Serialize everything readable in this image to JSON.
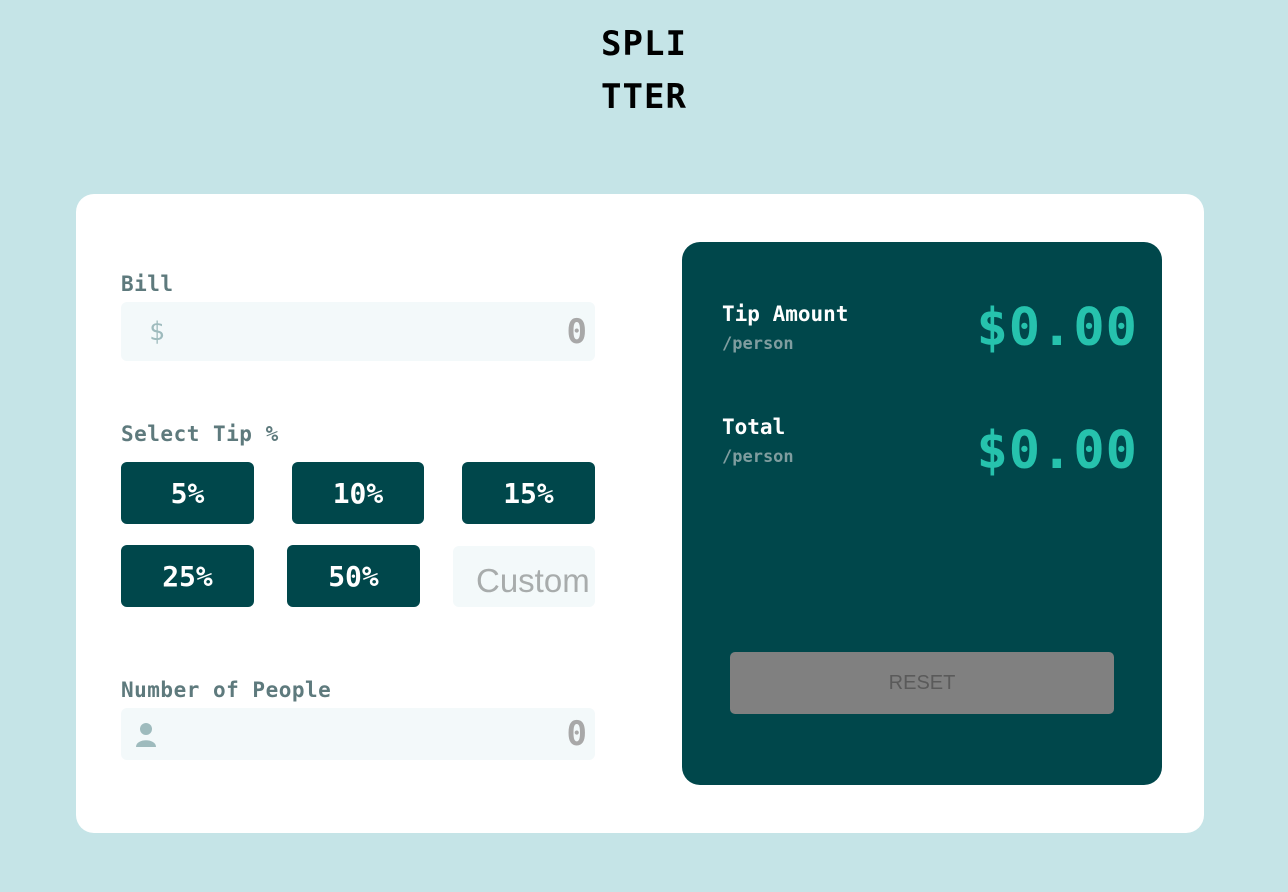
{
  "app": {
    "logo_line1": "SPLI",
    "logo_line2": "TTER"
  },
  "bill": {
    "label": "Bill",
    "prefix": "$",
    "value": "0",
    "icon": "dollar-icon"
  },
  "tip": {
    "label": "Select Tip %",
    "options": [
      "5%",
      "10%",
      "15%",
      "25%",
      "50%"
    ],
    "custom_placeholder": "Custom"
  },
  "people": {
    "label": "Number of People",
    "value": "0",
    "icon": "person-icon"
  },
  "results": {
    "tip_amount_label": "Tip Amount",
    "tip_amount_sub": "/person",
    "tip_amount_value": "$0.00",
    "total_label": "Total",
    "total_sub": "/person",
    "total_value": "$0.00",
    "reset_label": "RESET"
  },
  "colors": {
    "background": "#c5e4e7",
    "card": "#ffffff",
    "dark_cyan": "#00474b",
    "accent": "#26c2ad",
    "input_bg": "#f3f9fa",
    "reset_disabled": "#808080"
  }
}
